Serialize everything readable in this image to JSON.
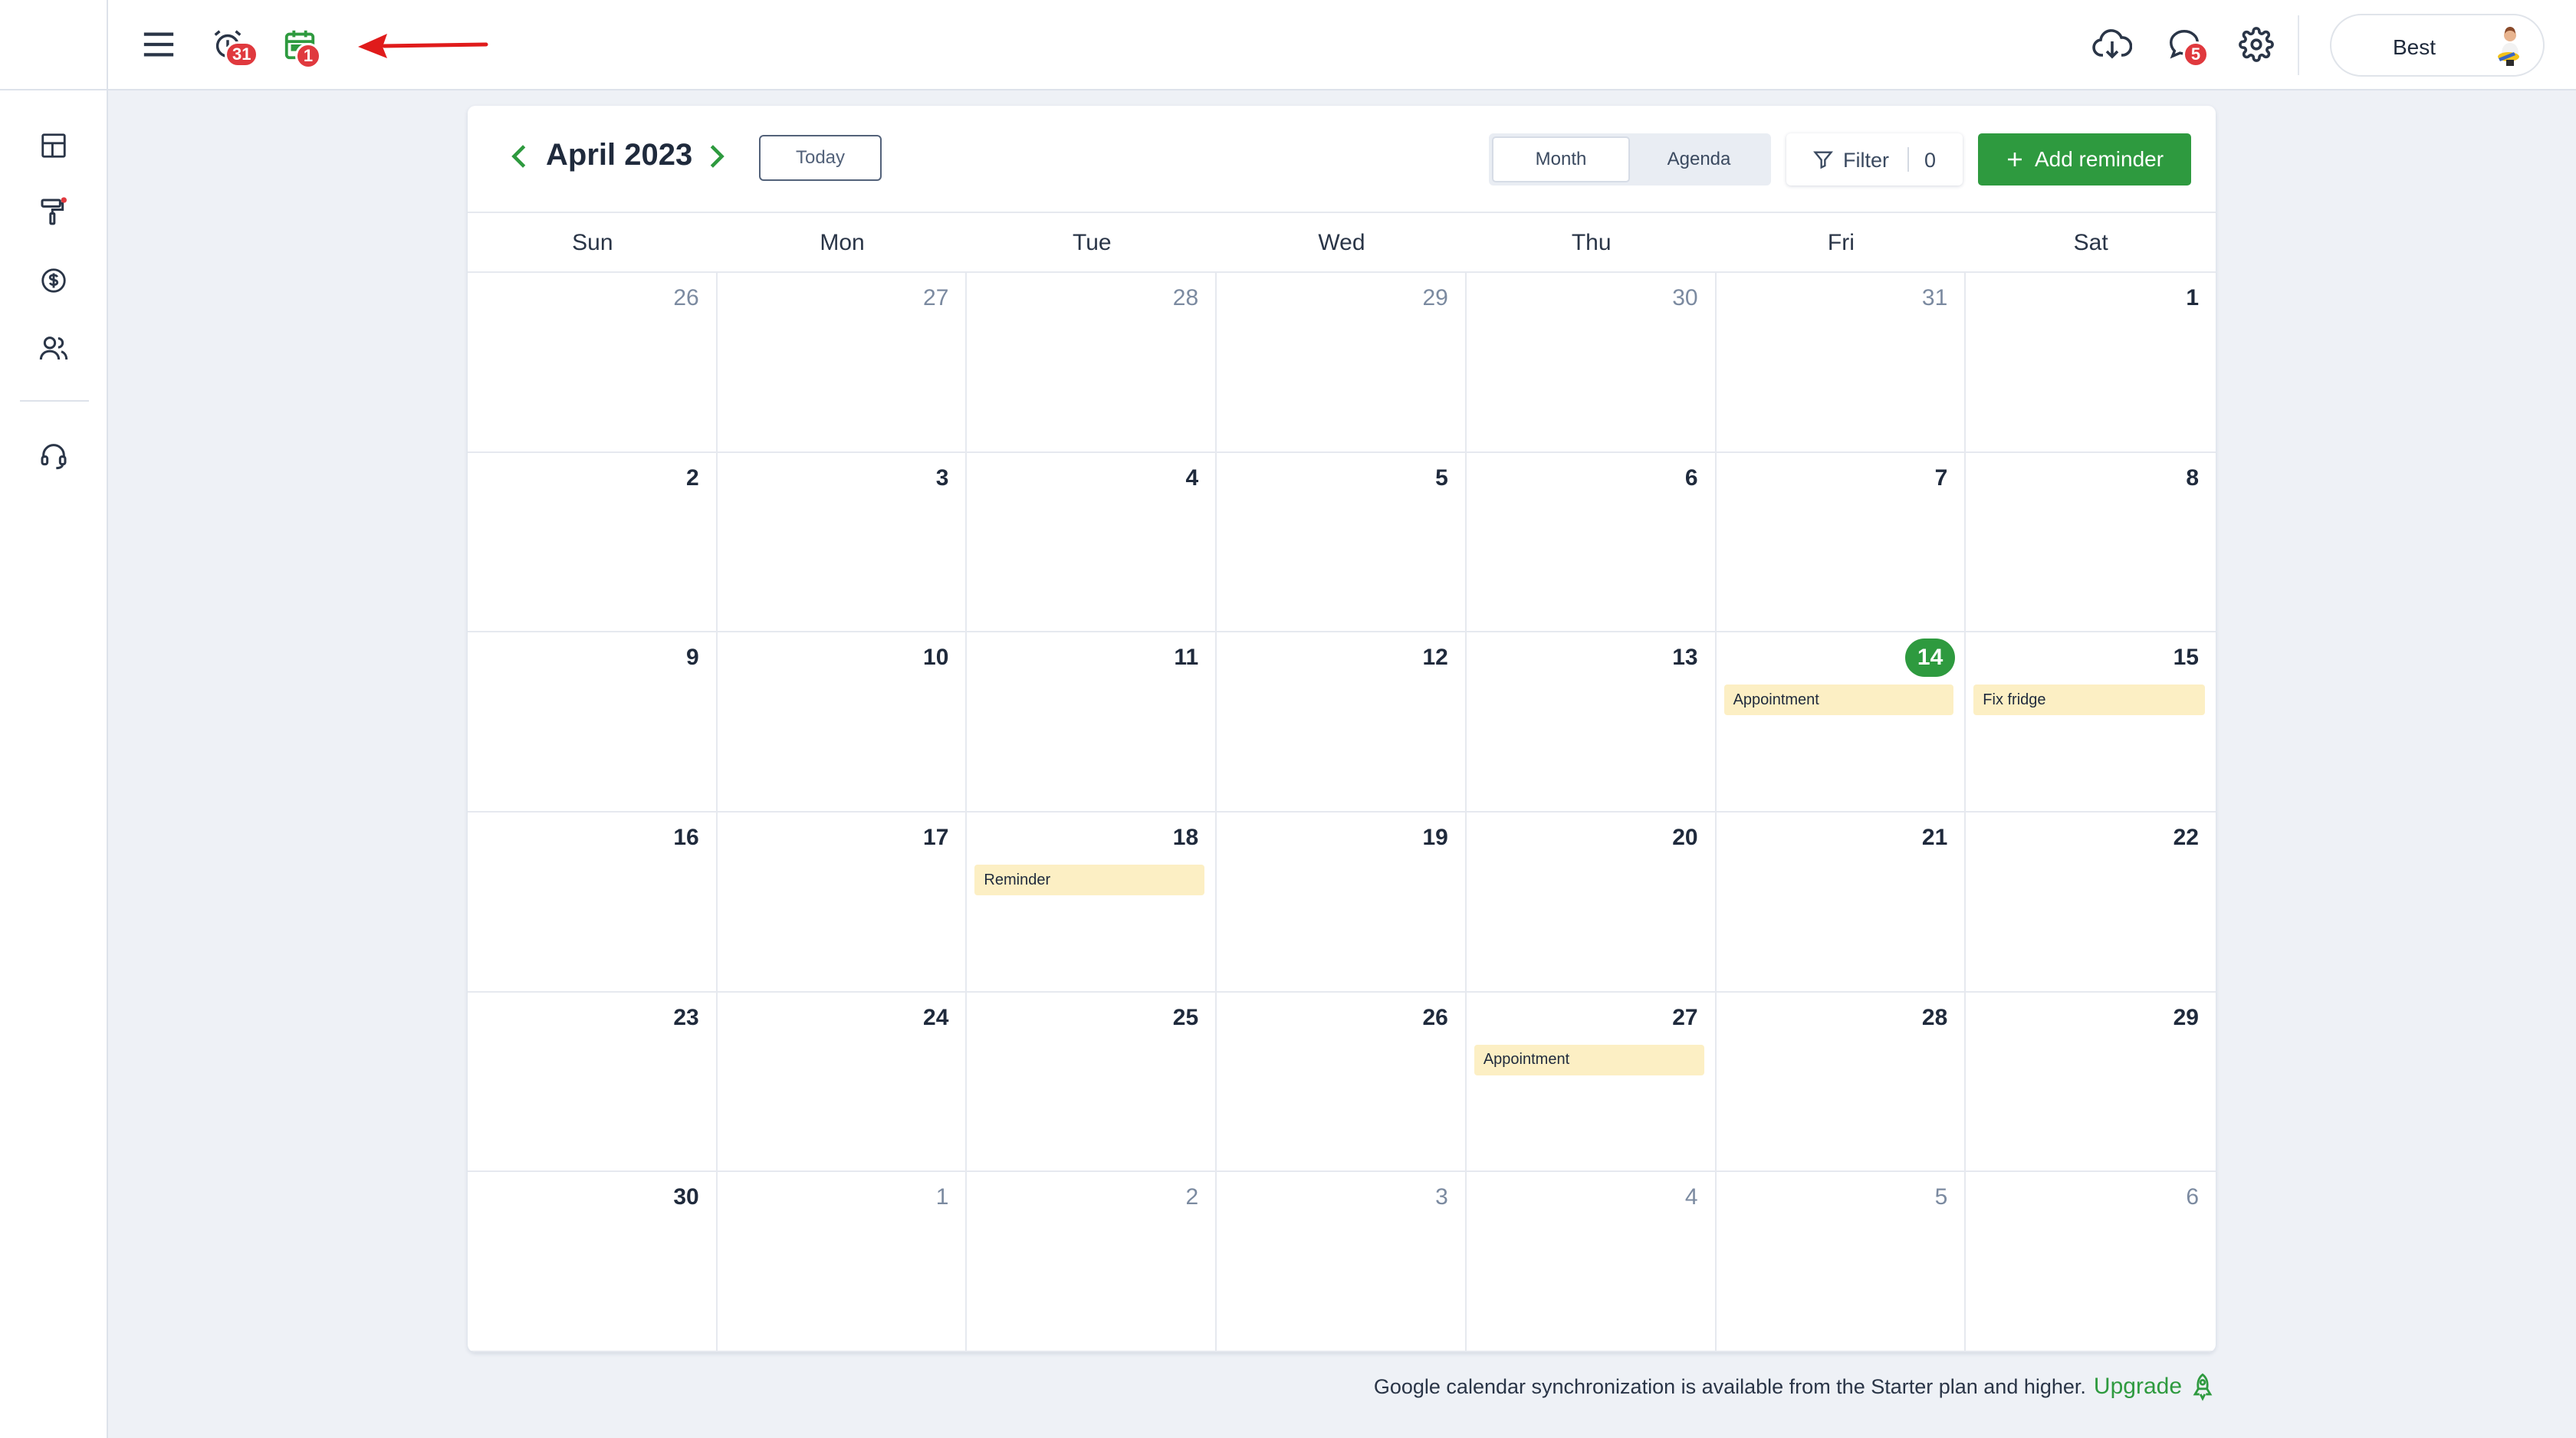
{
  "topbar": {
    "reminder_badge": "31",
    "calendar_badge": "1",
    "chat_badge": "5",
    "user_name": "Best"
  },
  "calendar": {
    "month_title": "April 2023",
    "today_label": "Today",
    "view_options": [
      "Month",
      "Agenda"
    ],
    "active_view": "Month",
    "filter_label": "Filter",
    "filter_count": "0",
    "add_label": "Add reminder",
    "weekdays": [
      "Sun",
      "Mon",
      "Tue",
      "Wed",
      "Thu",
      "Fri",
      "Sat"
    ],
    "today_date": "14",
    "days": [
      {
        "n": "26",
        "other": true
      },
      {
        "n": "27",
        "other": true
      },
      {
        "n": "28",
        "other": true
      },
      {
        "n": "29",
        "other": true
      },
      {
        "n": "30",
        "other": true
      },
      {
        "n": "31",
        "other": true
      },
      {
        "n": "1"
      },
      {
        "n": "2"
      },
      {
        "n": "3"
      },
      {
        "n": "4"
      },
      {
        "n": "5"
      },
      {
        "n": "6"
      },
      {
        "n": "7"
      },
      {
        "n": "8"
      },
      {
        "n": "9"
      },
      {
        "n": "10"
      },
      {
        "n": "11"
      },
      {
        "n": "12"
      },
      {
        "n": "13"
      },
      {
        "n": "14",
        "today": true,
        "event": "Appointment"
      },
      {
        "n": "15",
        "event": "Fix fridge"
      },
      {
        "n": "16"
      },
      {
        "n": "17"
      },
      {
        "n": "18",
        "event": "Reminder"
      },
      {
        "n": "19"
      },
      {
        "n": "20"
      },
      {
        "n": "21"
      },
      {
        "n": "22"
      },
      {
        "n": "23"
      },
      {
        "n": "24"
      },
      {
        "n": "25"
      },
      {
        "n": "26"
      },
      {
        "n": "27",
        "event": "Appointment"
      },
      {
        "n": "28"
      },
      {
        "n": "29"
      },
      {
        "n": "30"
      },
      {
        "n": "1",
        "other": true
      },
      {
        "n": "2",
        "other": true
      },
      {
        "n": "3",
        "other": true
      },
      {
        "n": "4",
        "other": true
      },
      {
        "n": "5",
        "other": true
      },
      {
        "n": "6",
        "other": true
      }
    ]
  },
  "footer": {
    "note": "Google calendar synchronization is available from the Starter plan and higher.",
    "upgrade_label": "Upgrade"
  },
  "colors": {
    "accent": "#2e9a3f",
    "badge": "#e0393e",
    "event_bg": "#fcefc4",
    "arrow": "#e01b1b"
  }
}
